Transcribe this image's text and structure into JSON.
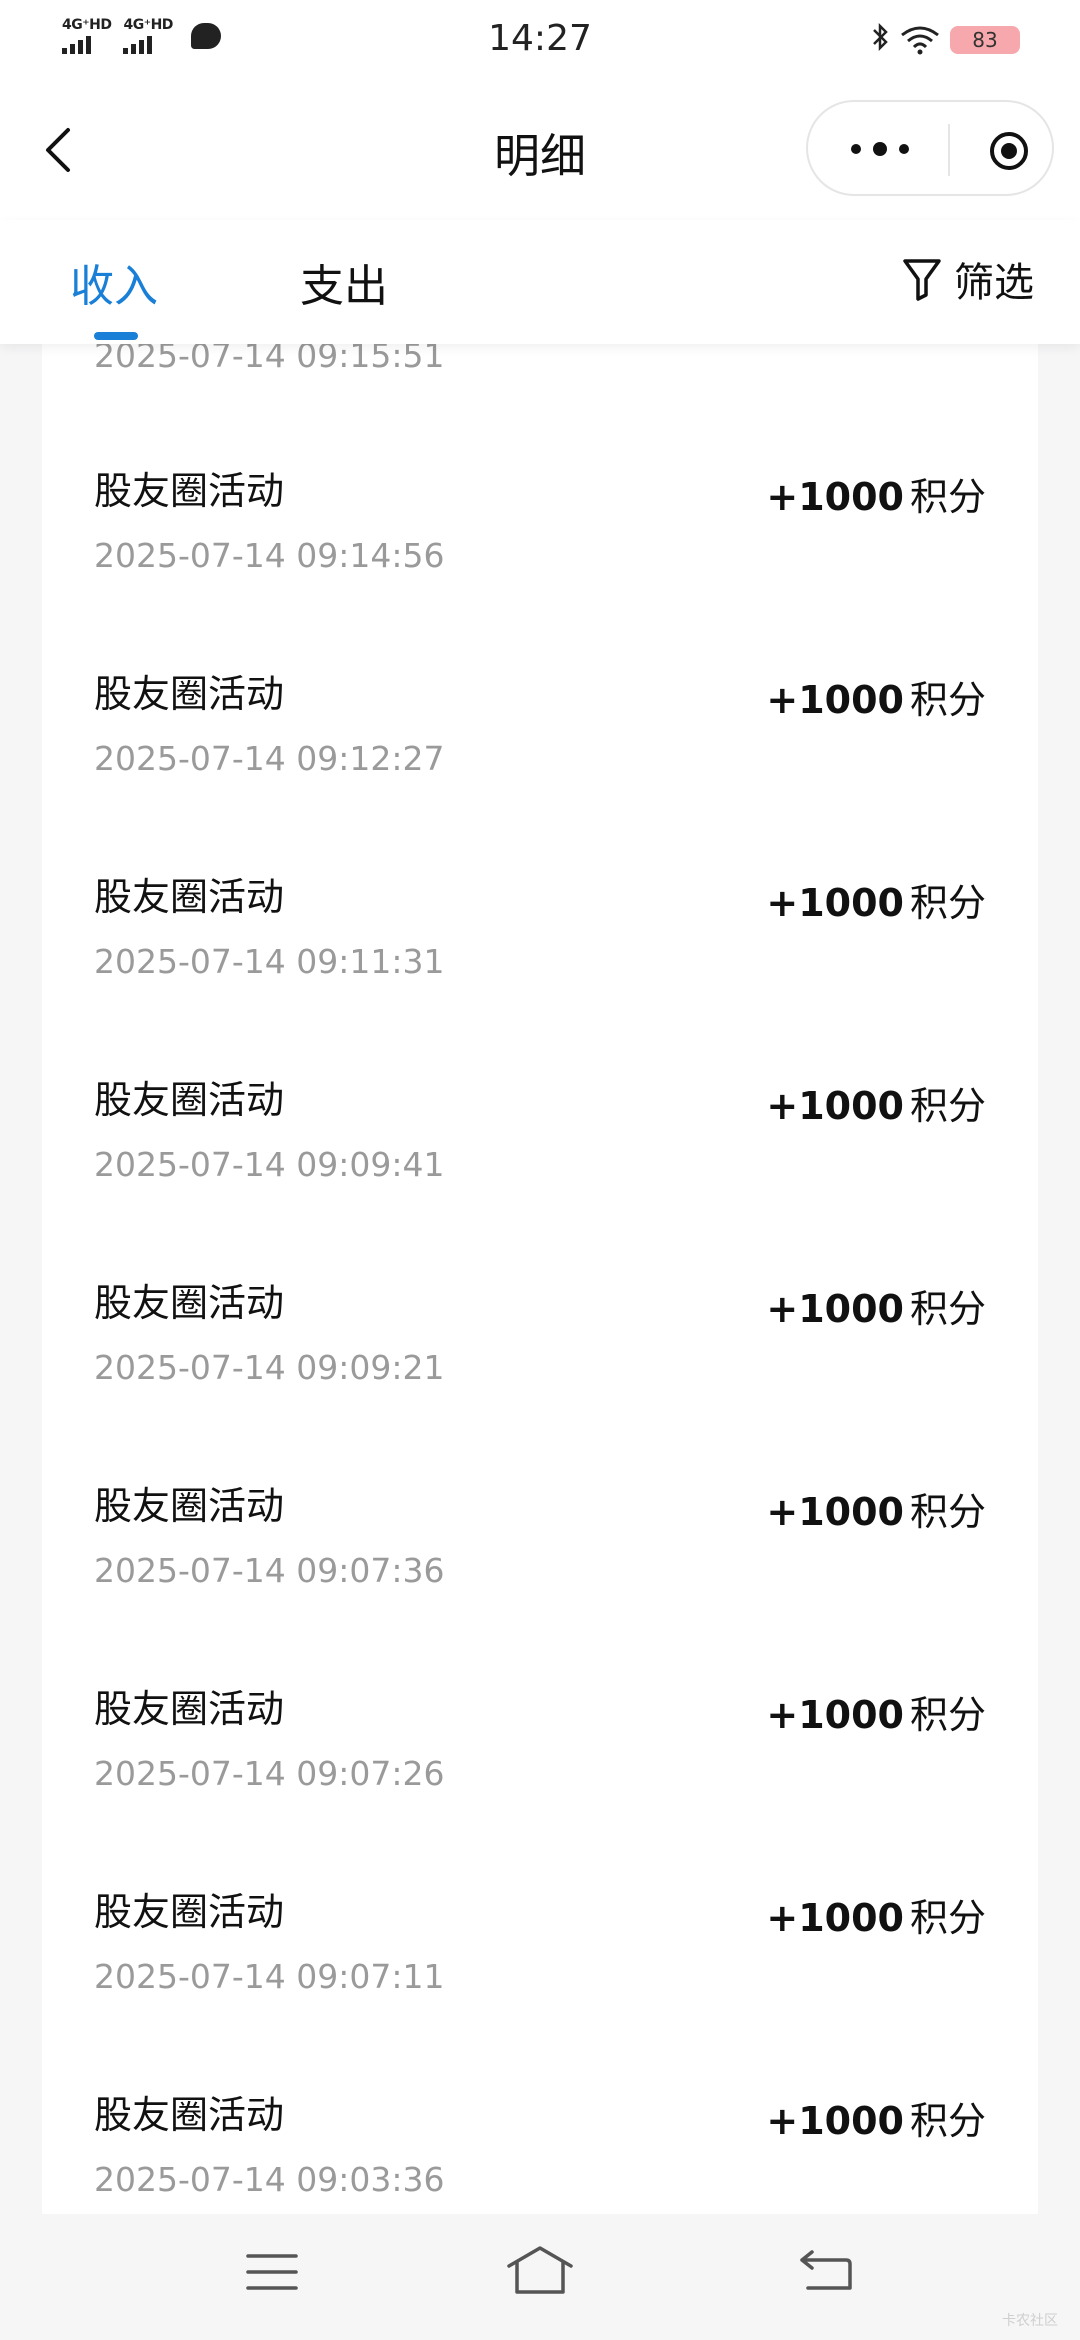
{
  "status_bar": {
    "sim1": "4G⁺HD",
    "sim2": "4G⁺HD",
    "time": "14:27",
    "battery": "83",
    "icons": [
      "signal-icon",
      "chat-bubble-icon",
      "bluetooth-icon",
      "wifi-icon",
      "battery-icon"
    ]
  },
  "header": {
    "title": "明细",
    "icons": [
      "back-icon",
      "more-icon",
      "target-icon"
    ]
  },
  "tabs": {
    "income": "收入",
    "expense": "支出",
    "filter": "筛选",
    "active": "income",
    "accent": "#1a7fd6"
  },
  "list": {
    "partial_time": "2025-07-14 09:15:51",
    "items": [
      {
        "title": "股友圈活动",
        "time": "2025-07-14 09:14:56",
        "amount": "+1000",
        "unit": "积分"
      },
      {
        "title": "股友圈活动",
        "time": "2025-07-14 09:12:27",
        "amount": "+1000",
        "unit": "积分"
      },
      {
        "title": "股友圈活动",
        "time": "2025-07-14 09:11:31",
        "amount": "+1000",
        "unit": "积分"
      },
      {
        "title": "股友圈活动",
        "time": "2025-07-14 09:09:41",
        "amount": "+1000",
        "unit": "积分"
      },
      {
        "title": "股友圈活动",
        "time": "2025-07-14 09:09:21",
        "amount": "+1000",
        "unit": "积分"
      },
      {
        "title": "股友圈活动",
        "time": "2025-07-14 09:07:36",
        "amount": "+1000",
        "unit": "积分"
      },
      {
        "title": "股友圈活动",
        "time": "2025-07-14 09:07:26",
        "amount": "+1000",
        "unit": "积分"
      },
      {
        "title": "股友圈活动",
        "time": "2025-07-14 09:07:11",
        "amount": "+1000",
        "unit": "积分"
      },
      {
        "title": "股友圈活动",
        "time": "2025-07-14 09:03:36",
        "amount": "+1000",
        "unit": "积分"
      }
    ]
  },
  "bottom_nav": {
    "icons": [
      "menu-icon",
      "home-icon",
      "return-icon"
    ],
    "watermark": "卡农社区"
  }
}
